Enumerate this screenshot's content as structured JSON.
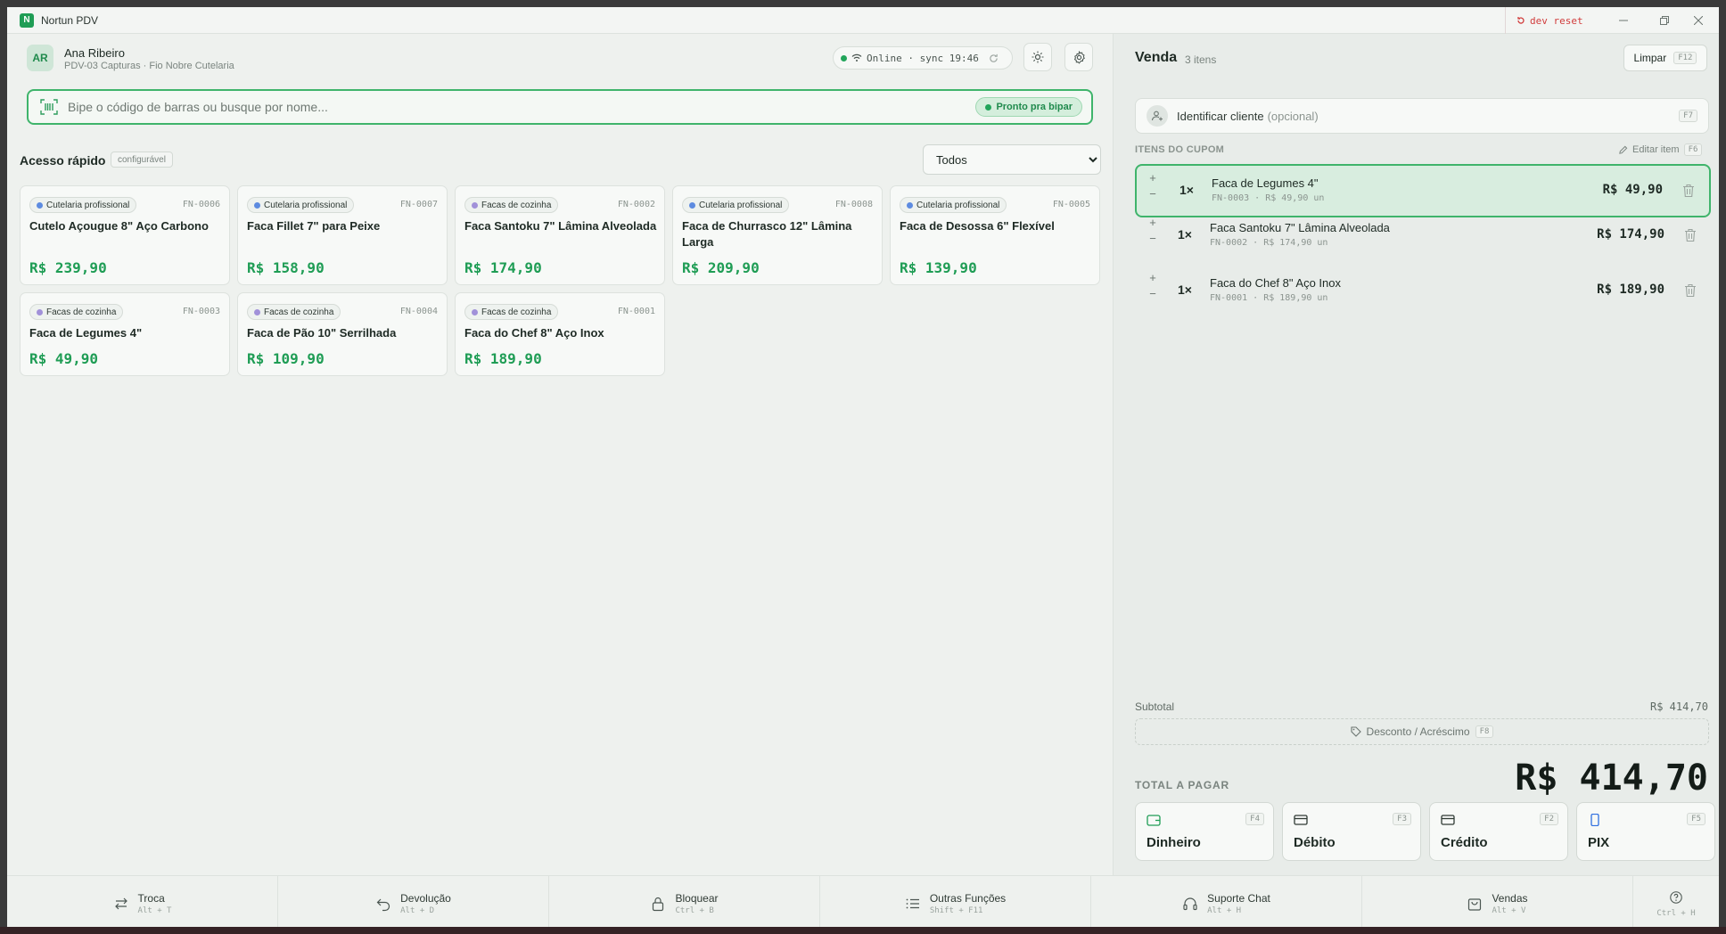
{
  "app": {
    "logo_letter": "N",
    "title": "Nortun PDV",
    "dev_reset": "dev reset"
  },
  "user": {
    "initials": "AR",
    "name": "Ana Ribeiro",
    "subtitle": "PDV-03 Capturas · Fio Nobre Cutelaria"
  },
  "status": {
    "text": "Online · sync 19:46"
  },
  "search": {
    "placeholder": "Bipe o código de barras ou busque por nome...",
    "ready_label": "Pronto pra bipar"
  },
  "quick_access": {
    "title": "Acesso rápido",
    "tag": "configurável",
    "filter_selected": "Todos",
    "products": [
      {
        "category": "Cutelaria profissional",
        "sku": "FN-0006",
        "name": "Cutelo Açougue 8\" Aço Carbono",
        "price": "R$ 239,90"
      },
      {
        "category": "Cutelaria profissional",
        "sku": "FN-0007",
        "name": "Faca Fillet 7\" para Peixe",
        "price": "R$ 158,90"
      },
      {
        "category": "Facas de cozinha",
        "sku": "FN-0002",
        "name": "Faca Santoku 7\" Lâmina Alveolada",
        "price": "R$ 174,90"
      },
      {
        "category": "Cutelaria profissional",
        "sku": "FN-0008",
        "name": "Faca de Churrasco 12\" Lâmina Larga",
        "price": "R$ 209,90"
      },
      {
        "category": "Cutelaria profissional",
        "sku": "FN-0005",
        "name": "Faca de Desossa 6\" Flexível",
        "price": "R$ 139,90"
      },
      {
        "category": "Facas de cozinha",
        "sku": "FN-0003",
        "name": "Faca de Legumes 4\"",
        "price": "R$ 49,90"
      },
      {
        "category": "Facas de cozinha",
        "sku": "FN-0004",
        "name": "Faca de Pão 10\" Serrilhada",
        "price": "R$ 109,90"
      },
      {
        "category": "Facas de cozinha",
        "sku": "FN-0001",
        "name": "Faca do Chef 8\" Aço Inox",
        "price": "R$ 189,90"
      }
    ]
  },
  "sale": {
    "title": "Venda",
    "count": "3 itens",
    "clear_label": "Limpar",
    "clear_key": "F12",
    "client_label": "Identificar cliente",
    "client_optional": "(opcional)",
    "client_key": "F7",
    "items_header": "ITENS DO CUPOM",
    "edit_label": "Editar item",
    "edit_key": "F6",
    "items": [
      {
        "qty": "1×",
        "name": "Faca de Legumes 4\"",
        "sub": "FN-0003 · R$ 49,90 un",
        "total": "R$ 49,90"
      },
      {
        "qty": "1×",
        "name": "Faca Santoku 7\" Lâmina Alveolada",
        "sub": "FN-0002 · R$ 174,90 un",
        "total": "R$ 174,90"
      },
      {
        "qty": "1×",
        "name": "Faca do Chef 8\" Aço Inox",
        "sub": "FN-0001 · R$ 189,90 un",
        "total": "R$ 189,90"
      }
    ],
    "subtotal_label": "Subtotal",
    "subtotal_value": "R$ 414,70",
    "discount_label": "Desconto / Acréscimo",
    "discount_key": "F8",
    "total_label": "TOTAL A PAGAR",
    "total_value": "R$ 414,70",
    "payments": [
      {
        "label": "Dinheiro",
        "key": "F4",
        "icon": "wallet-icon",
        "color": "#1f9d55"
      },
      {
        "label": "Débito",
        "key": "F3",
        "icon": "card-icon",
        "color": "#2f3a34"
      },
      {
        "label": "Crédito",
        "key": "F2",
        "icon": "card-icon",
        "color": "#2f3a34"
      },
      {
        "label": "PIX",
        "key": "F5",
        "icon": "phone-icon",
        "color": "#2f6fe0"
      }
    ]
  },
  "footer": [
    {
      "label": "Troca",
      "key": "Alt + T",
      "icon": "swap-icon"
    },
    {
      "label": "Devolução",
      "key": "Alt + D",
      "icon": "undo-icon"
    },
    {
      "label": "Bloquear",
      "key": "Ctrl + B",
      "icon": "lock-icon"
    },
    {
      "label": "Outras Funções",
      "key": "Shift + F11",
      "icon": "list-icon"
    },
    {
      "label": "Suporte Chat",
      "key": "Alt + H",
      "icon": "headset-icon"
    },
    {
      "label": "Vendas",
      "key": "Alt + V",
      "icon": "bag-icon"
    },
    {
      "label": "",
      "key": "Ctrl + H",
      "icon": "help-icon"
    }
  ]
}
